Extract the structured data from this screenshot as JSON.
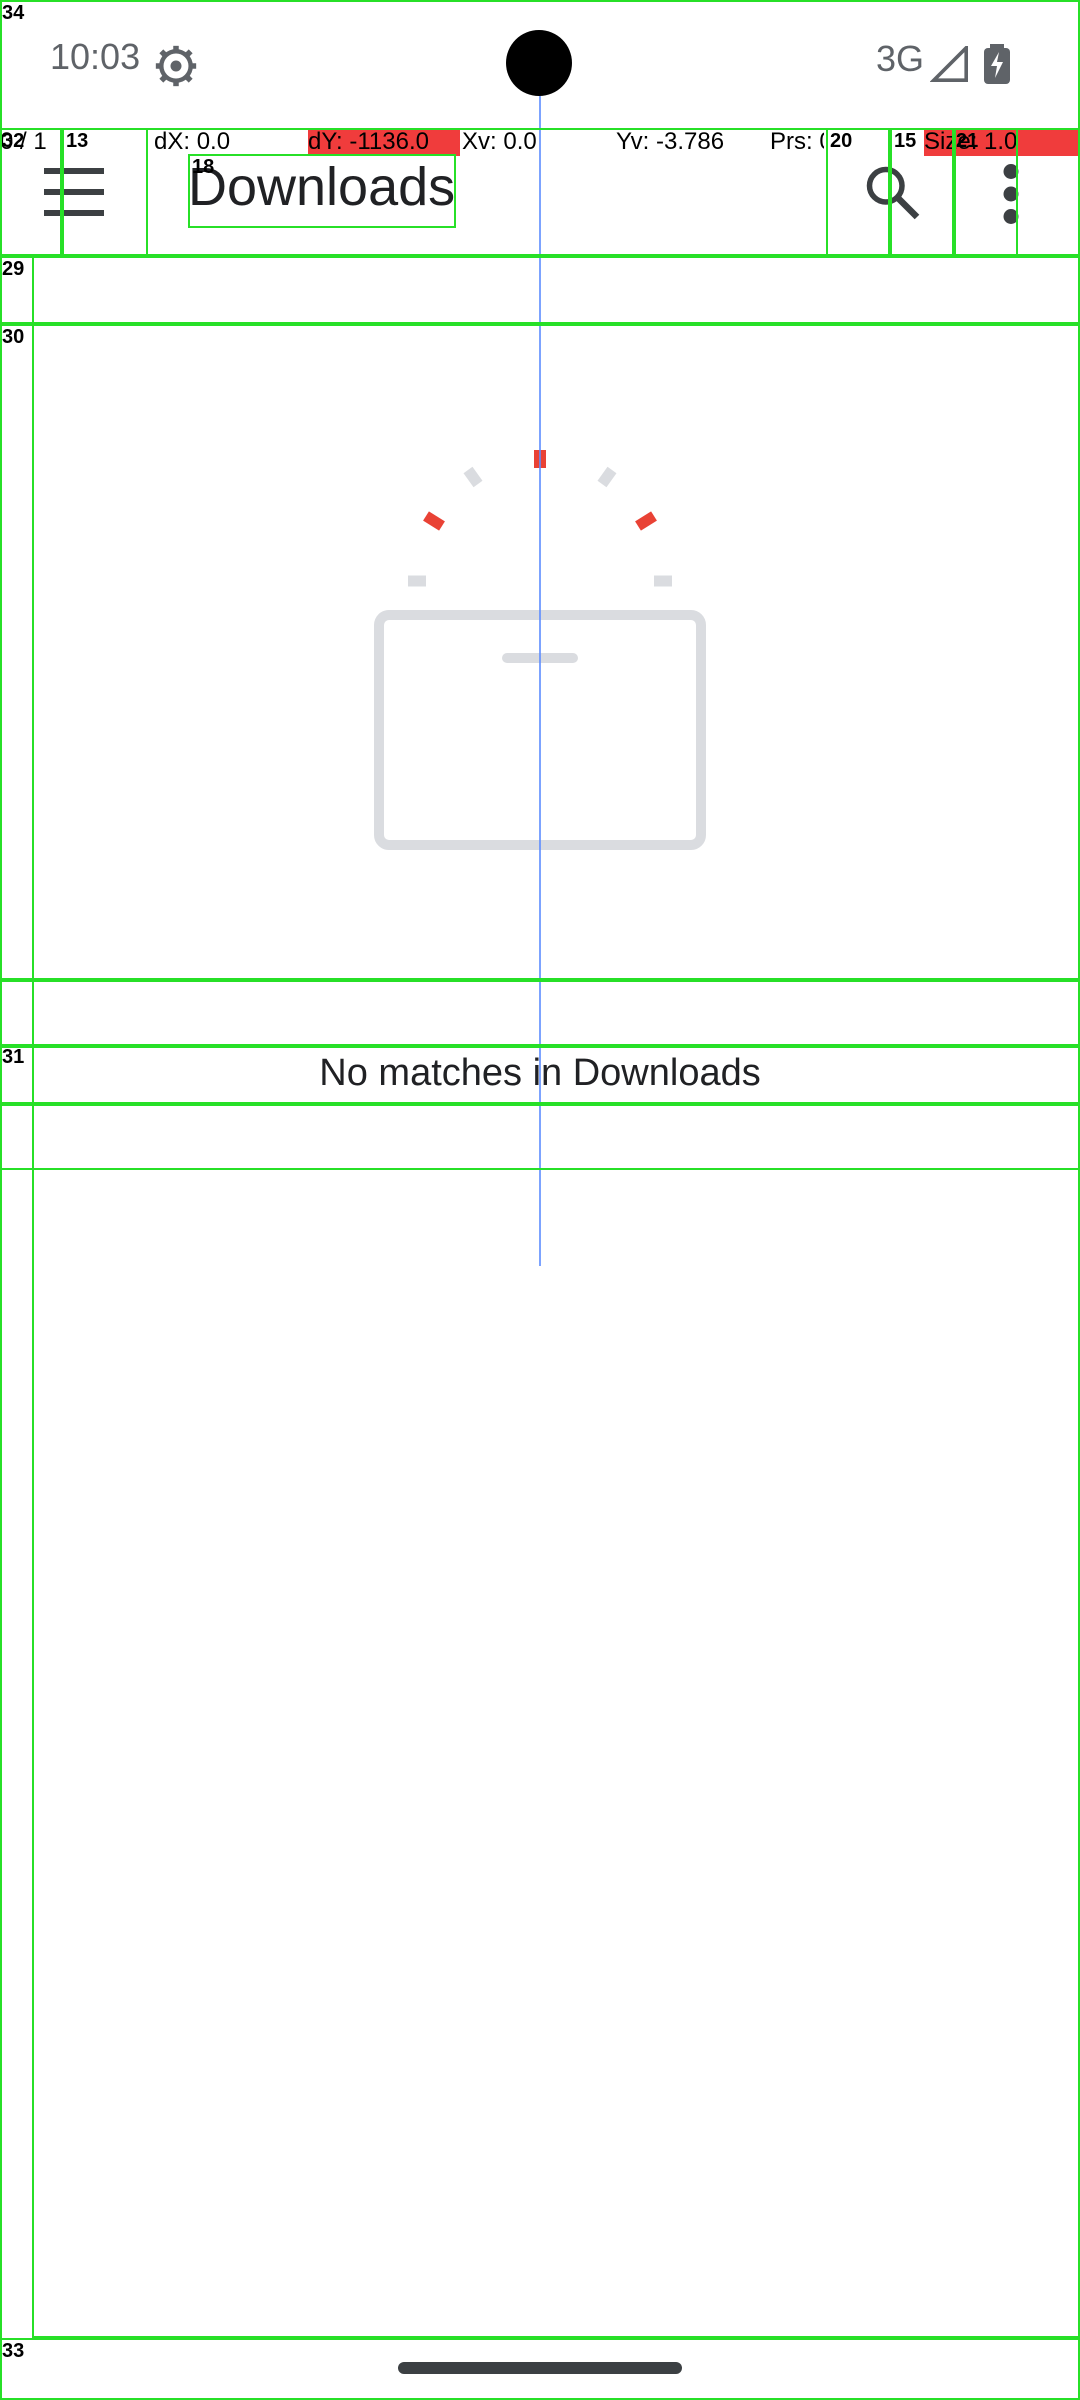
{
  "status_bar": {
    "time": "10:03",
    "network": "3G",
    "icons": [
      "settings-gear-icon",
      "signal-icon",
      "battery-charging-icon"
    ]
  },
  "debug_overlay": {
    "pointer": "0 / 1",
    "dx": "dX: 0.0",
    "dy": "dY: -1136.0",
    "xv": "Xv: 0.0",
    "yv": "Yv: -3.786",
    "prs": "Prs: 0",
    "size": "Size: 1.0",
    "colors": {
      "highlight": "#f03c3c",
      "crosshair": "#5b8cff",
      "bounds": "#27e027"
    }
  },
  "toolbar": {
    "title": "Downloads",
    "menu_icon": "hamburger-menu-icon",
    "search_icon": "search-icon",
    "overflow_icon": "more-vert-icon"
  },
  "empty_state": {
    "message": "No matches in Downloads",
    "illustration": "empty-folder-illustration",
    "colors": {
      "accent": "#e94235",
      "neutral": "#dadce0"
    }
  },
  "layout_bounds_labels": [
    "34",
    "32",
    "13",
    "18",
    "20",
    "15",
    "21",
    "29",
    "30",
    "31",
    "33"
  ]
}
